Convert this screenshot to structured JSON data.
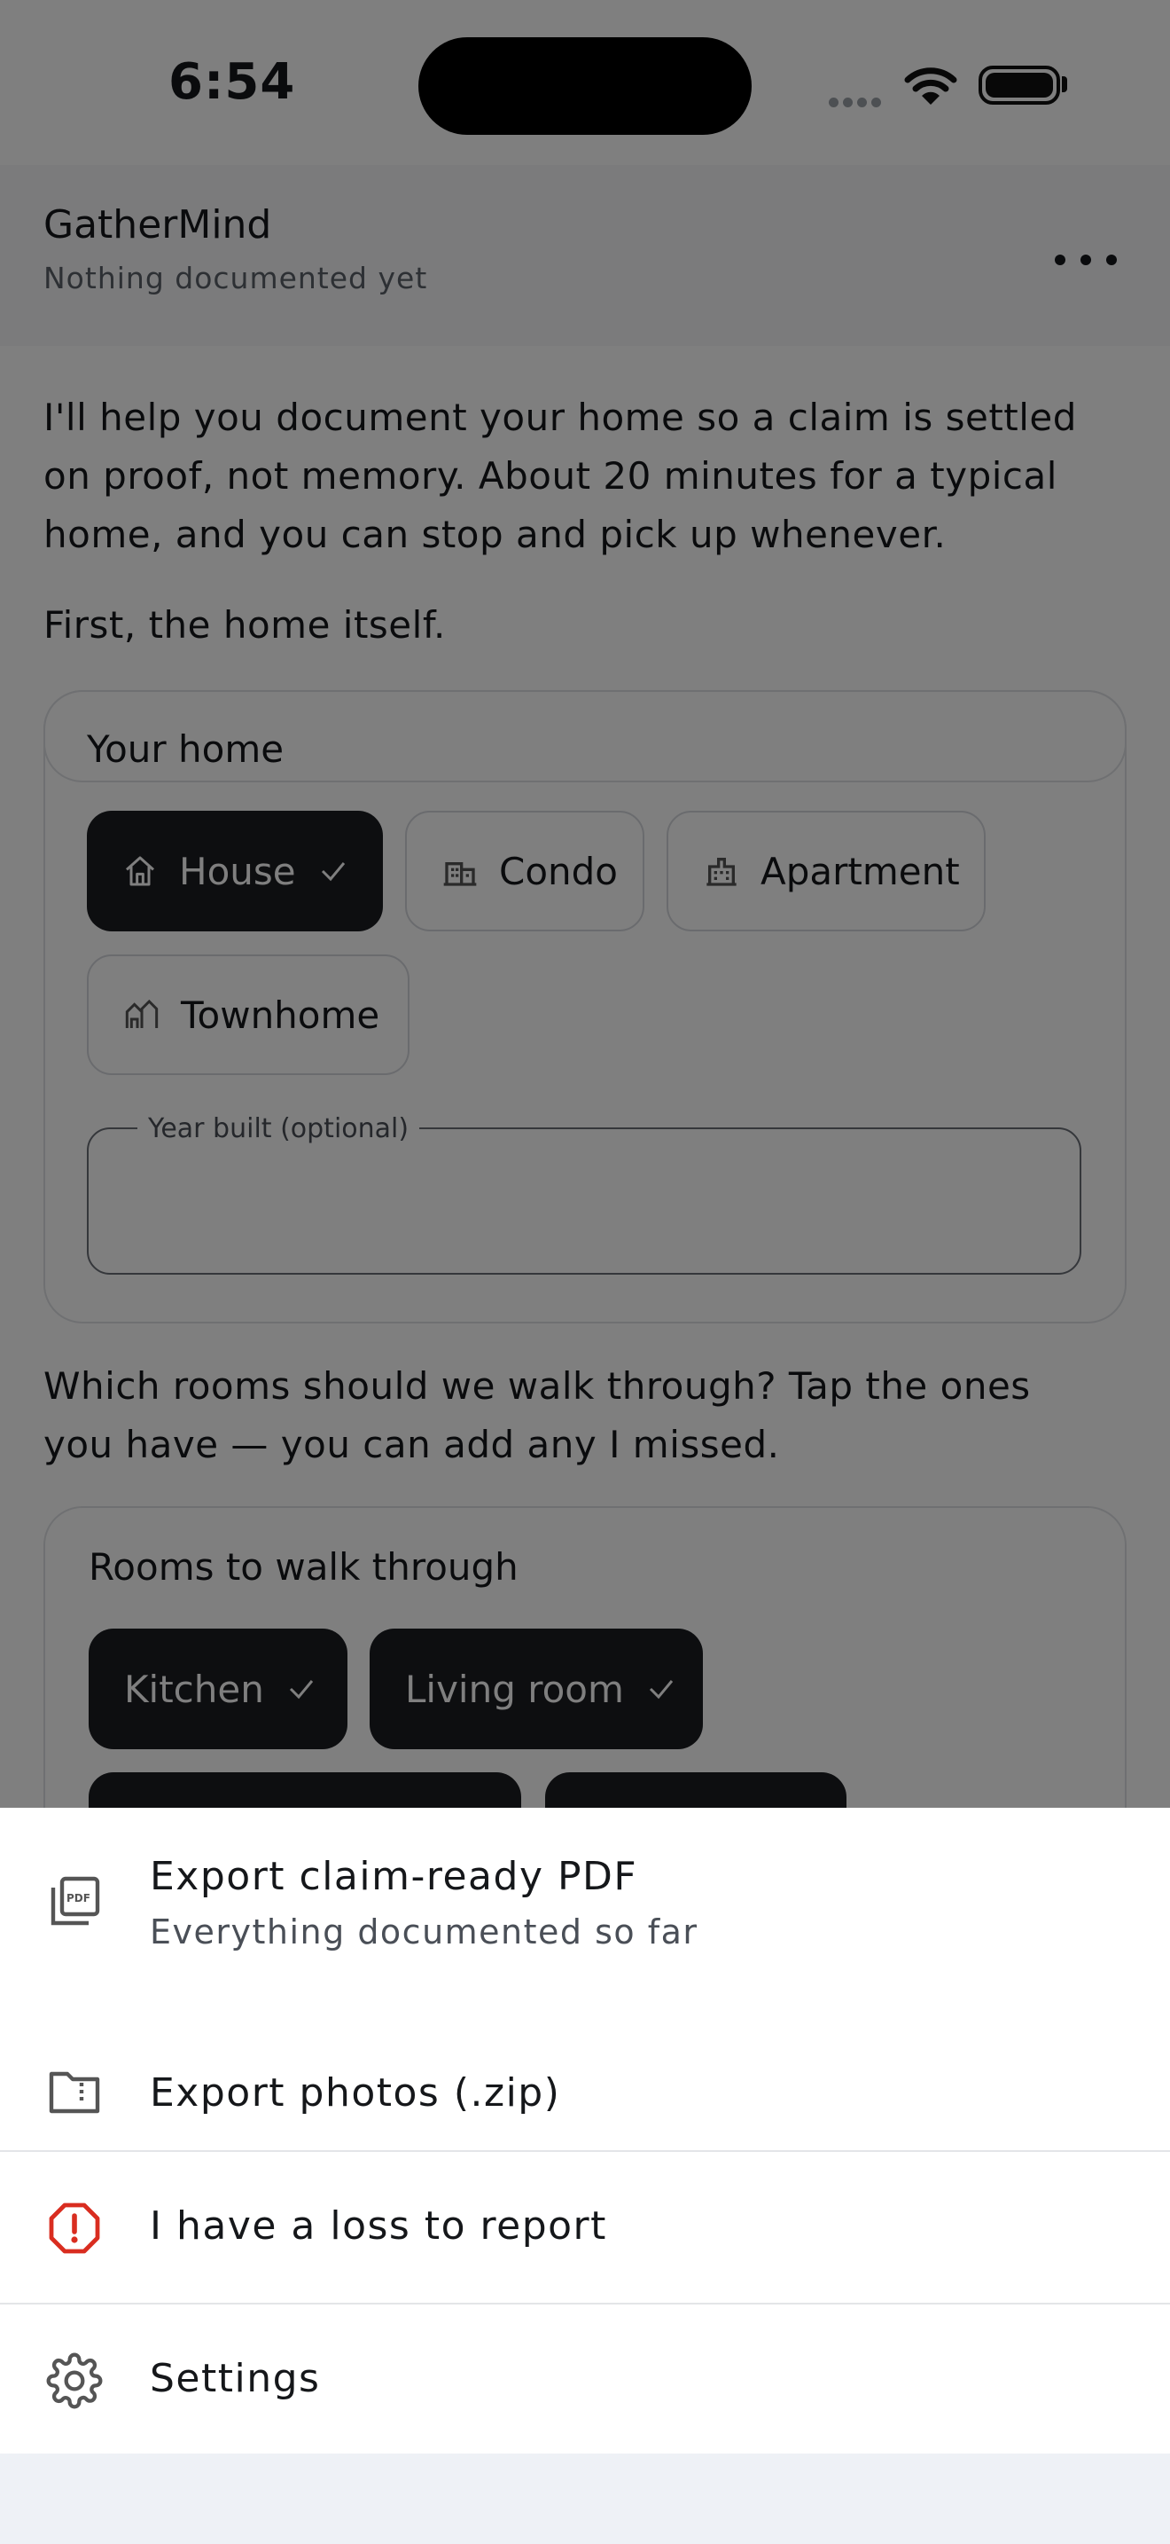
{
  "status_bar": {
    "time": "6:54"
  },
  "header": {
    "title": "GatherMind",
    "subtitle": "Nothing documented yet",
    "more_icon": "more-horizontal-icon"
  },
  "intro": {
    "paragraph": "I'll help you document your home so a claim is settled on proof, not memory. About 20 minutes for a typical home, and you can stop and pick up whenever.",
    "prompt": "First, the home itself."
  },
  "home_card": {
    "title": "Your home",
    "types": [
      {
        "label": "House",
        "icon": "house-icon",
        "selected": true
      },
      {
        "label": "Condo",
        "icon": "building-icon",
        "selected": false
      },
      {
        "label": "Apartment",
        "icon": "apartment-icon",
        "selected": false
      },
      {
        "label": "Townhome",
        "icon": "townhome-icon",
        "selected": false
      }
    ],
    "year_built_label": "Year built (optional)",
    "year_built_value": ""
  },
  "rooms_prompt": "Which rooms should we walk through? Tap the ones you have — you can add any I missed.",
  "rooms_card": {
    "title": "Rooms to walk through",
    "rooms": [
      {
        "label": "Kitchen",
        "selected": true
      },
      {
        "label": "Living room",
        "selected": true
      }
    ]
  },
  "sheet": {
    "items": [
      {
        "label": "Export claim-ready PDF",
        "sublabel": "Everything documented so far",
        "icon": "pdf-file-icon"
      },
      {
        "label": "Export photos (.zip)",
        "icon": "zip-folder-icon"
      },
      {
        "label": "I have a loss to report",
        "icon": "alert-octagon-icon",
        "accent": "#d92d20"
      },
      {
        "label": "Settings",
        "icon": "gear-icon"
      }
    ]
  },
  "colors": {
    "chip_selected": "#1a1c20",
    "alert": "#d92d20",
    "sheet_bottom": "#eef1f6"
  }
}
